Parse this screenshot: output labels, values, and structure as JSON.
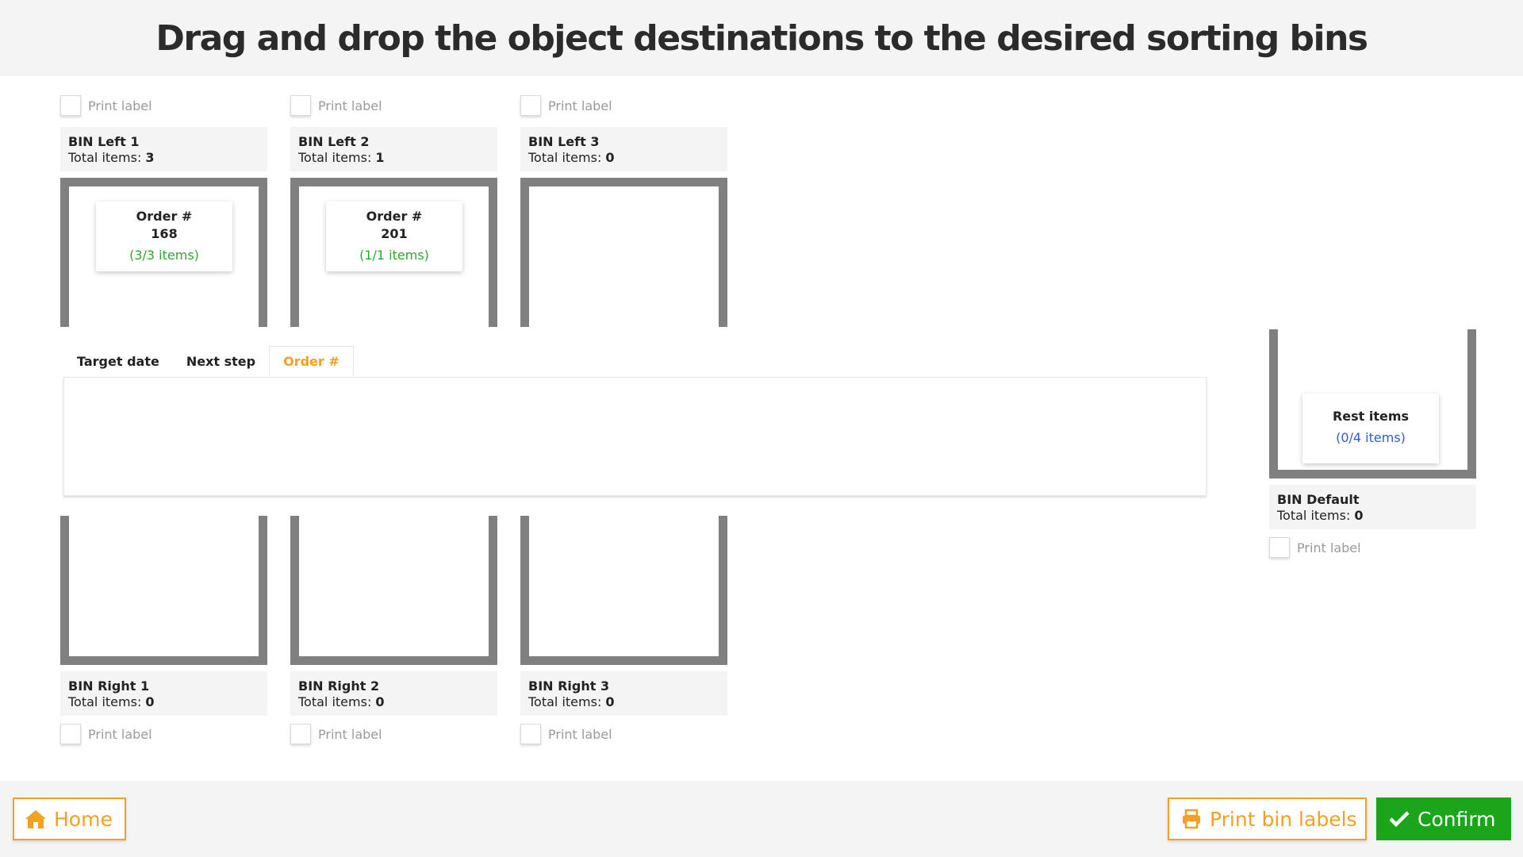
{
  "header": {
    "title": "Drag and drop the object destinations to the desired sorting bins"
  },
  "total_items_label": "Total items:",
  "print_label": "Print label",
  "bins_top": [
    {
      "name": "BIN Left 1",
      "total": "3",
      "card": {
        "title": "Order #",
        "sub": "168",
        "count": "(3/3 items)"
      }
    },
    {
      "name": "BIN Left 2",
      "total": "1",
      "card": {
        "title": "Order #",
        "sub": "201",
        "count": "(1/1 items)"
      }
    },
    {
      "name": "BIN Left 3",
      "total": "0"
    }
  ],
  "bins_bottom": [
    {
      "name": "BIN Right 1",
      "total": "0"
    },
    {
      "name": "BIN Right 2",
      "total": "0"
    },
    {
      "name": "BIN Right 3",
      "total": "0"
    }
  ],
  "bin_default": {
    "name": "BIN Default",
    "total": "0",
    "card": {
      "title": "Rest items",
      "count": "(0/4 items)"
    }
  },
  "tabs": [
    {
      "label": "Target date",
      "active": false
    },
    {
      "label": "Next step",
      "active": false
    },
    {
      "label": "Order #",
      "active": true
    }
  ],
  "footer": {
    "home_label": "Home",
    "print_bin_labels": "Print bin labels",
    "confirm_label": "Confirm"
  },
  "icons": {
    "home": "home-icon",
    "print": "print-icon",
    "confirm": "checkmark-icon"
  },
  "colors": {
    "accent": "#f4a020",
    "confirm": "#1aa51a",
    "complete": "#2ca82c",
    "rest": "#2f5dc9",
    "bin_wall": "#808080"
  }
}
